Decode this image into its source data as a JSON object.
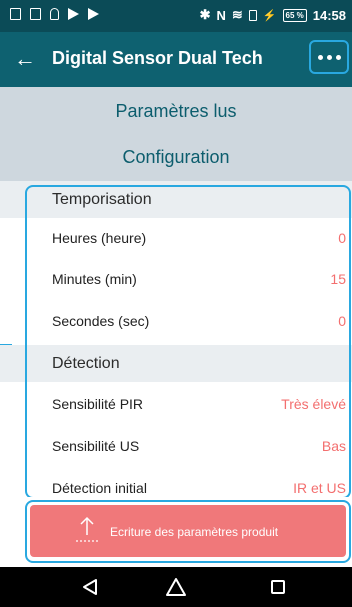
{
  "status_bar": {
    "time": "14:58",
    "battery": "65 %",
    "bolt": "⚡",
    "bluetooth": "✱",
    "nfc": "N",
    "wifi": "≋",
    "icons": [
      "gallery-icon",
      "clipboard-icon",
      "bulb-icon",
      "play-store-icon",
      "play-icon"
    ]
  },
  "app_bar": {
    "back": "←",
    "title": "Digital Sensor Dual Tech"
  },
  "sections": {
    "read_params": "Paramètres lus",
    "configuration": "Configuration"
  },
  "groups": [
    {
      "title": "Temporisation",
      "rows": [
        {
          "label": "Heures (heure)",
          "value": "0"
        },
        {
          "label": "Minutes (min)",
          "value": "15"
        },
        {
          "label": "Secondes (sec)",
          "value": "0"
        }
      ]
    },
    {
      "title": "Détection",
      "rows": [
        {
          "label": "Sensibilité PIR",
          "value": "Très élevé"
        },
        {
          "label": "Sensibilité US",
          "value": "Bas"
        },
        {
          "label": "Détection initial",
          "value": "IR et US"
        }
      ]
    }
  ],
  "write_button": {
    "label": "Ecriture des paramètres produit",
    "icon": "upload-icon"
  },
  "nav_bar": {
    "icons": [
      "back-triangle-icon",
      "home-icon",
      "recents-icon"
    ]
  },
  "colors": {
    "status_bar": "#0b4b57",
    "app_bar": "#0e6170",
    "section_bg": "#ced7de",
    "section_text": "#0c5d6d",
    "value_text": "#f36f6f",
    "write_button": "#f0787a",
    "highlight": "#29a8e0"
  }
}
